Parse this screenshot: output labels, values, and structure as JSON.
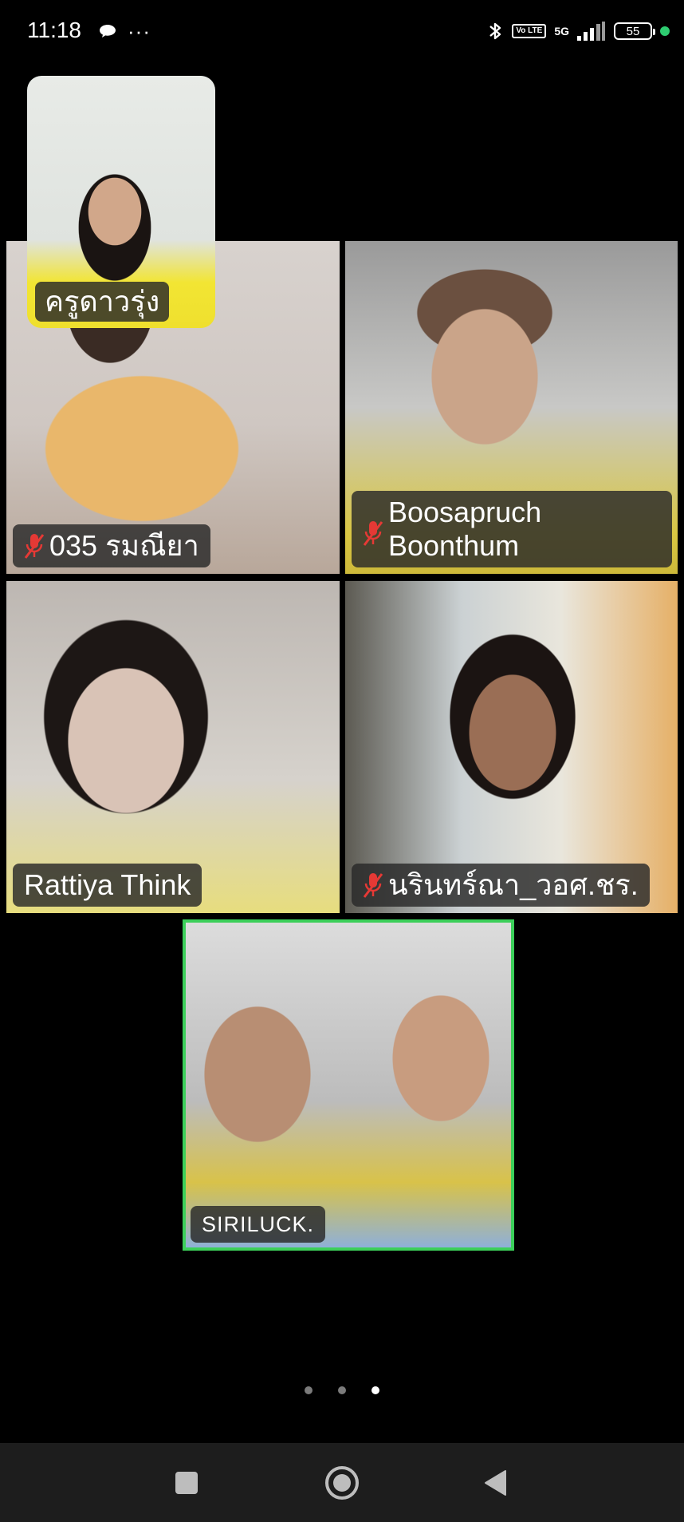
{
  "status_bar": {
    "time": "11:18",
    "more": "···",
    "volte": "Vo LTE",
    "network": "5G",
    "battery": "55",
    "icons": [
      "chat-bubble-icon",
      "bluetooth-icon",
      "volte-icon",
      "signal-icon",
      "battery-icon",
      "privacy-dot-icon"
    ]
  },
  "self_view": {
    "name": "ครูดาวรุ่ง"
  },
  "participants": [
    {
      "name": "035 รมณียา",
      "muted": true
    },
    {
      "name": "Boosapruch Boonthum",
      "muted": true
    },
    {
      "name": "Rattiya Think",
      "muted": false
    },
    {
      "name": "นรินทร์ณา_วอศ.ชร.",
      "muted": true
    },
    {
      "name": "SIRILUCK.",
      "muted": false,
      "active_speaker": true
    }
  ],
  "pager": {
    "pages": 3,
    "current": 3
  },
  "colors": {
    "active_speaker_border": "#3ccf5a",
    "mute_icon": "#e53935",
    "label_bg": "#282828"
  },
  "nav": {
    "icons": [
      "recent-apps-icon",
      "home-icon",
      "back-icon"
    ]
  }
}
